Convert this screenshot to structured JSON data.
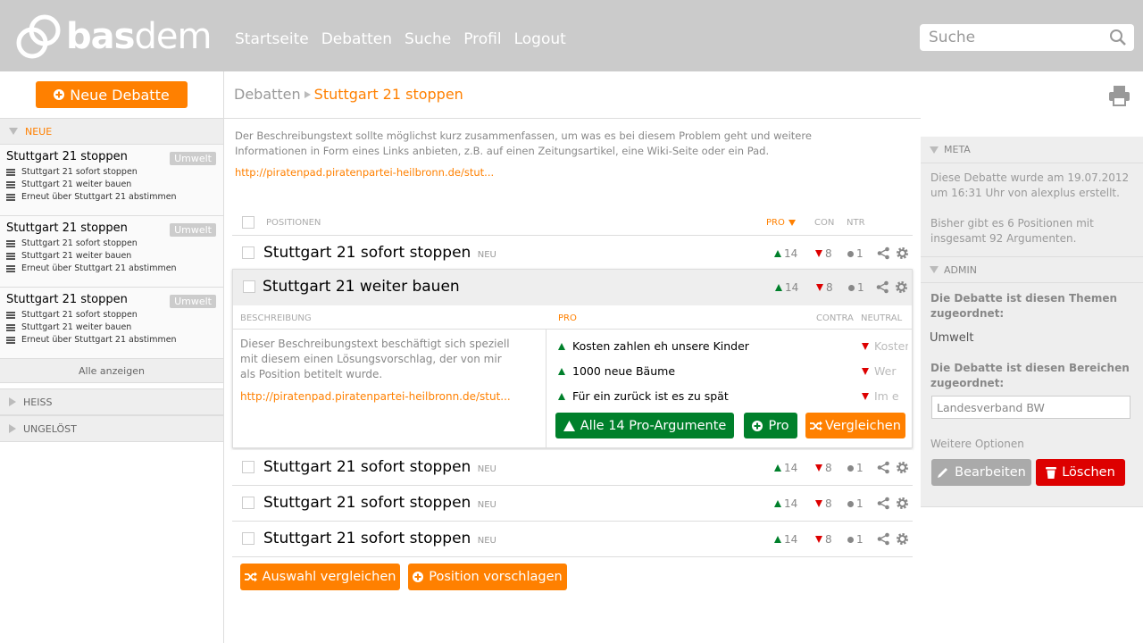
{
  "header": {
    "logo_bold": "bas",
    "logo_light": "dem",
    "nav": [
      "Startseite",
      "Debatten",
      "Suche",
      "Profil",
      "Logout"
    ],
    "search_placeholder": "Suche"
  },
  "sidebar": {
    "new_debate_label": "Neue Debatte",
    "sections": {
      "neue": "NEUE",
      "heiss": "HEISS",
      "ungeloest": "UNGELÖST"
    },
    "groups": [
      {
        "title": "Stuttgart 21 stoppen",
        "badge": "Umwelt",
        "items": [
          "Stuttgart 21 sofort stoppen",
          "Stuttgart 21 weiter bauen",
          "Erneut über Stuttgart 21 abstimmen"
        ]
      },
      {
        "title": "Stuttgart 21 stoppen",
        "badge": "Umwelt",
        "items": [
          "Stuttgart 21 sofort stoppen",
          "Stuttgart 21 weiter bauen",
          "Erneut über Stuttgart 21 abstimmen"
        ]
      },
      {
        "title": "Stuttgart 21 stoppen",
        "badge": "Umwelt",
        "items": [
          "Stuttgart 21 sofort stoppen",
          "Stuttgart 21 weiter bauen",
          "Erneut über Stuttgart 21 abstimmen"
        ]
      }
    ],
    "show_all": "Alle anzeigen"
  },
  "main": {
    "breadcrumb_root": "Debatten",
    "breadcrumb_current": "Stuttgart 21 stoppen",
    "description": "Der Beschreibungstext sollte möglichst kurz zusammenfassen, um was es bei diesem Problem geht und weitere Informationen in Form eines Links anbieten, z.B. auf einen Zeitungsartikel, eine Wiki-Seite oder ein Pad.",
    "description_link": "http://piratenpad.piratenpartei-heilbronn.de/stut...",
    "columns": {
      "positions": "POSITIONEN",
      "pro": "PRO",
      "con": "CON",
      "ntr": "NTR"
    },
    "rows": [
      {
        "title": "Stuttgart 21 sofort stoppen",
        "tag": "NEU",
        "pro": "14",
        "con": "8",
        "ntr": "1"
      },
      {
        "title": "Stuttgart 21 weiter bauen",
        "tag": "",
        "pro": "14",
        "con": "8",
        "ntr": "1"
      },
      {
        "title": "Stuttgart 21 sofort stoppen",
        "tag": "NEU",
        "pro": "14",
        "con": "8",
        "ntr": "1"
      },
      {
        "title": "Stuttgart 21 sofort stoppen",
        "tag": "NEU",
        "pro": "14",
        "con": "8",
        "ntr": "1"
      },
      {
        "title": "Stuttgart 21 sofort stoppen",
        "tag": "NEU",
        "pro": "14",
        "con": "8",
        "ntr": "1"
      }
    ],
    "expanded": {
      "cols": {
        "desc": "BESCHREIBUNG",
        "pro": "PRO",
        "contra": "CONTRA",
        "neutral": "NEUTRAL"
      },
      "description": "Dieser Beschreibungstext beschäftigt sich speziell mit diesem einen Lösungsvorschlag, der von mir als Position betitelt wurde.",
      "link": "http://piratenpad.piratenpartei-heilbronn.de/stut...",
      "pro_args": [
        "Kosten zahlen eh unsere Kinder",
        "1000 neue Bäume",
        "Für ein zurück ist es zu spät"
      ],
      "con_args": [
        "Kosten",
        "Wer",
        "Im e"
      ],
      "all_pro_btn": "Alle 14 Pro-Argumente",
      "pro_btn": "Pro",
      "compare_btn": "Vergleichen"
    },
    "compare_selection_btn": "Auswahl vergleichen",
    "propose_btn": "Position vorschlagen"
  },
  "right": {
    "meta_head": "META",
    "meta_text1": "Diese Debatte wurde am 19.07.2012 um 16:31 Uhr von alexplus erstellt.",
    "meta_text2": "Bisher gibt es 6 Positionen mit insgesamt 92 Argumenten.",
    "admin_head": "ADMIN",
    "topics_label": "Die Debatte ist diesen Themen zugeordnet:",
    "topic": "Umwelt",
    "areas_label": "Die Debatte ist diesen Bereichen zugeordnet:",
    "area_value": "Landesverband BW",
    "more_options": "Weitere Optionen",
    "edit_btn": "Bearbeiten",
    "delete_btn": "Löschen"
  },
  "colors": {
    "accent": "#ff8000",
    "pro": "#00802b",
    "con": "#dd0000",
    "header_bg": "#cbcbcb"
  }
}
